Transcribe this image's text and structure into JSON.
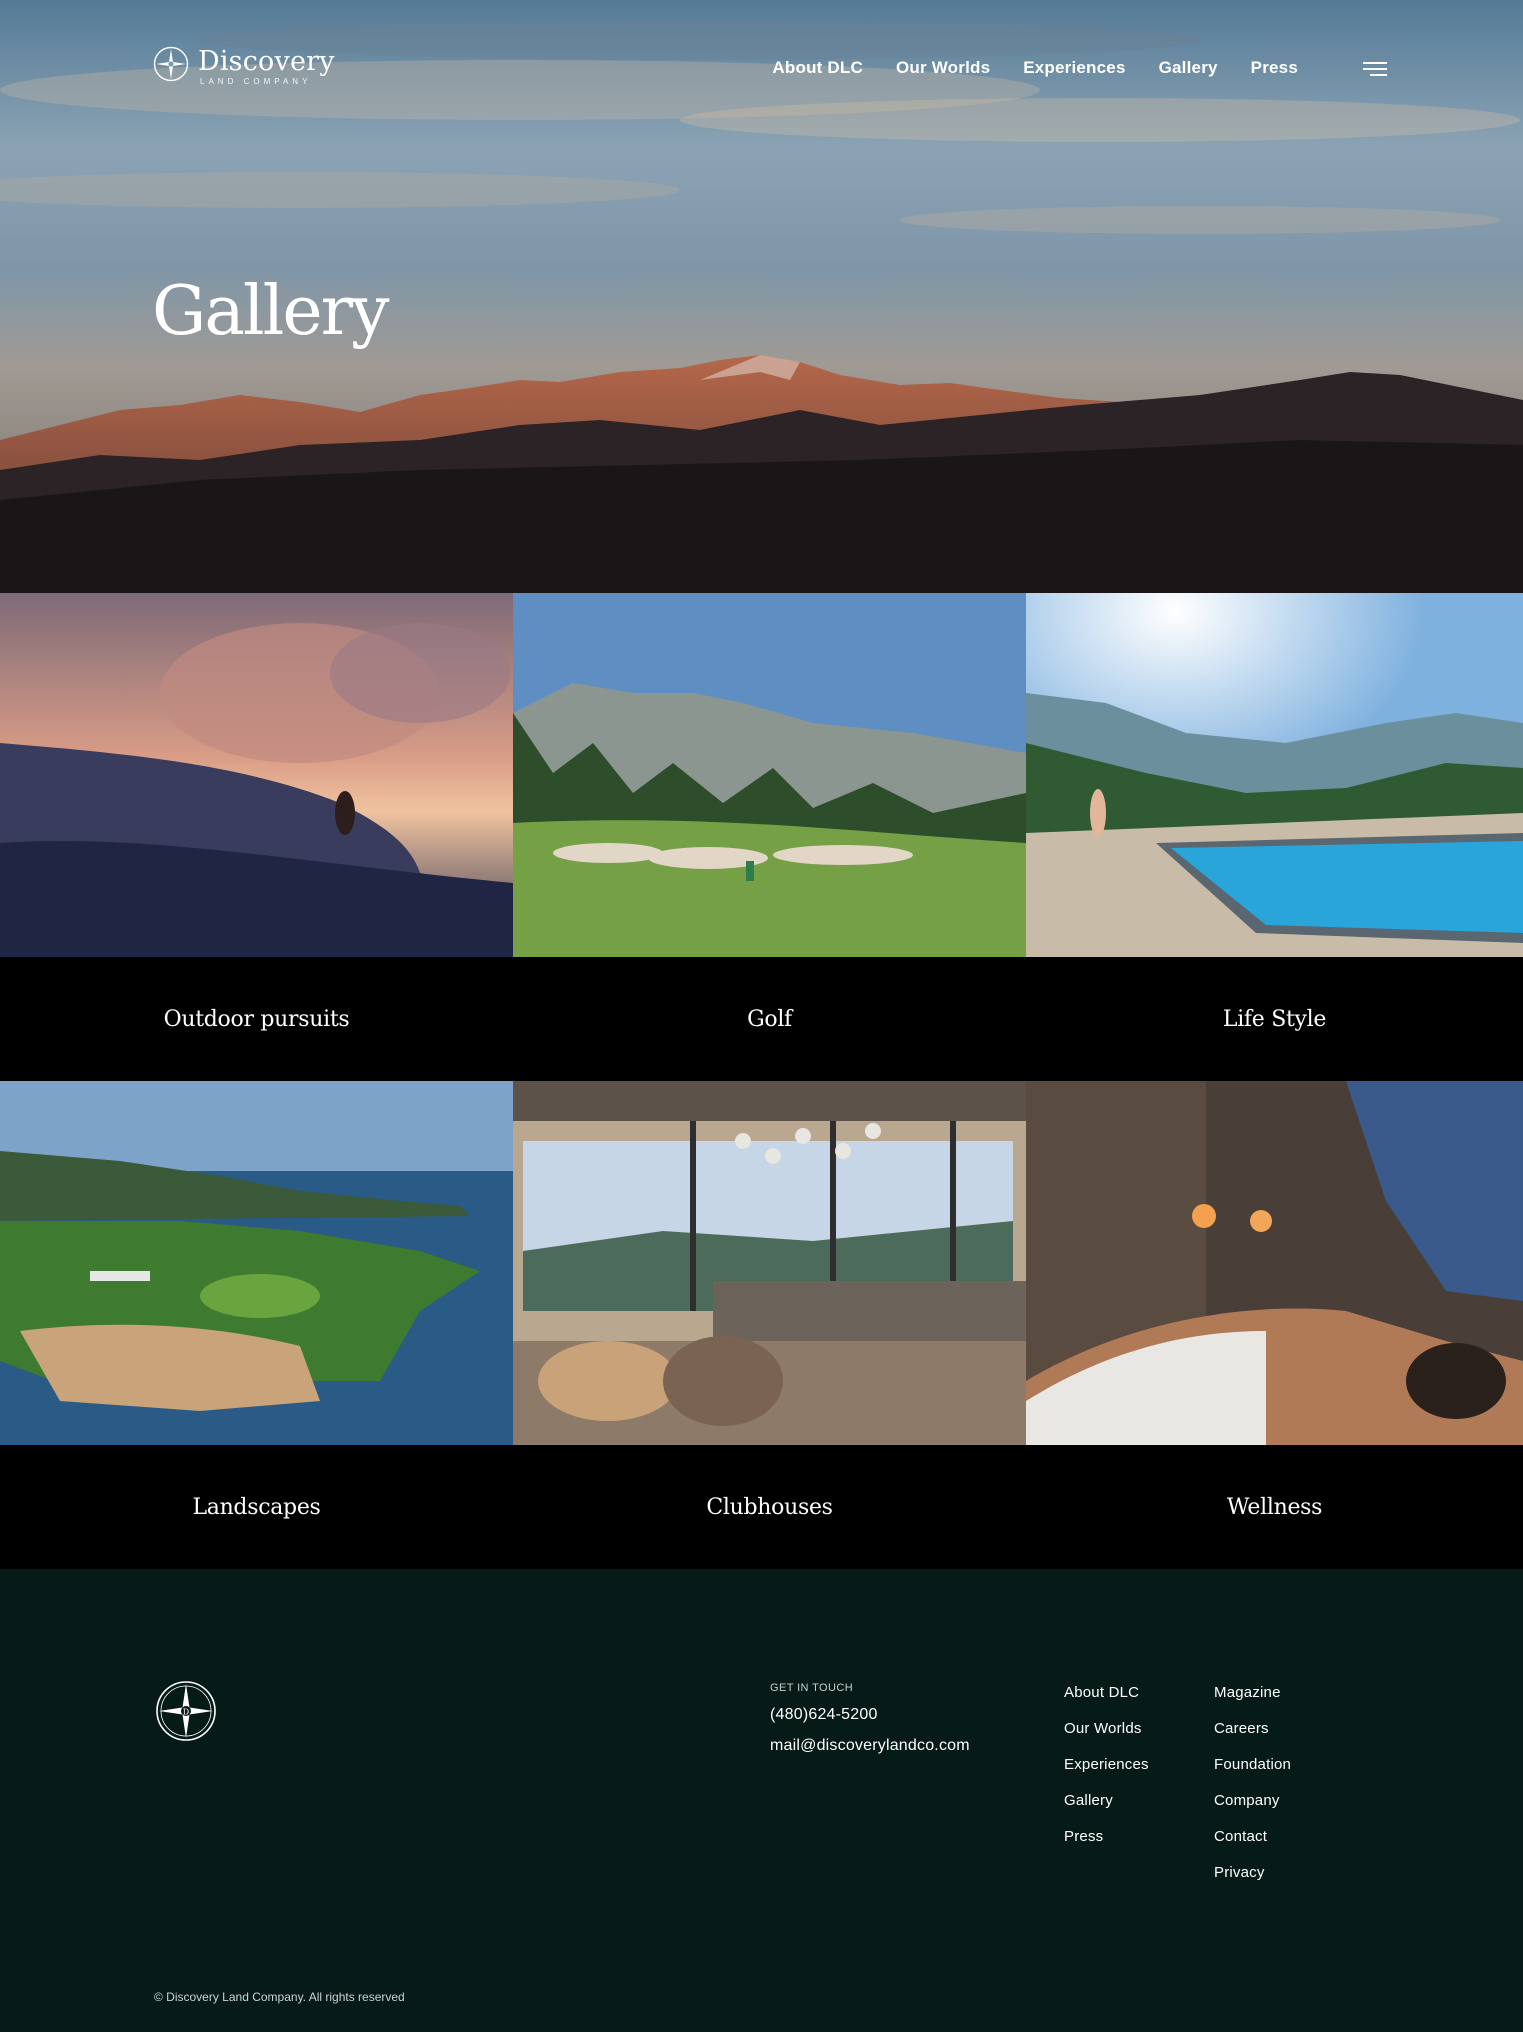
{
  "brand": {
    "name": "Discovery",
    "subtitle": "LAND COMPANY",
    "logo_icon": "compass-star-icon"
  },
  "nav": {
    "items": [
      "About DLC",
      "Our Worlds",
      "Experiences",
      "Gallery",
      "Press"
    ],
    "menu_icon": "hamburger-menu-icon"
  },
  "hero": {
    "title": "Gallery"
  },
  "gallery": {
    "cards": [
      {
        "label": "Outdoor pursuits"
      },
      {
        "label": "Golf"
      },
      {
        "label": "Life Style"
      },
      {
        "label": "Landscapes"
      },
      {
        "label": "Clubhouses"
      },
      {
        "label": "Wellness"
      }
    ]
  },
  "footer": {
    "logo_icon": "compass-star-icon",
    "contact": {
      "kicker": "GET IN TOUCH",
      "phone": "(480)624-5200",
      "email": "mail@discoverylandco.com"
    },
    "links_col1": [
      "About DLC",
      "Our Worlds",
      "Experiences",
      "Gallery",
      "Press"
    ],
    "links_col2": [
      "Magazine",
      "Careers",
      "Foundation",
      "Company",
      "Contact",
      "Privacy"
    ],
    "copyright": "© Discovery Land Company. All rights reserved"
  },
  "colors": {
    "footer_bg": "#061a18",
    "card_label_bg": "#000000",
    "text": "#ffffff"
  }
}
